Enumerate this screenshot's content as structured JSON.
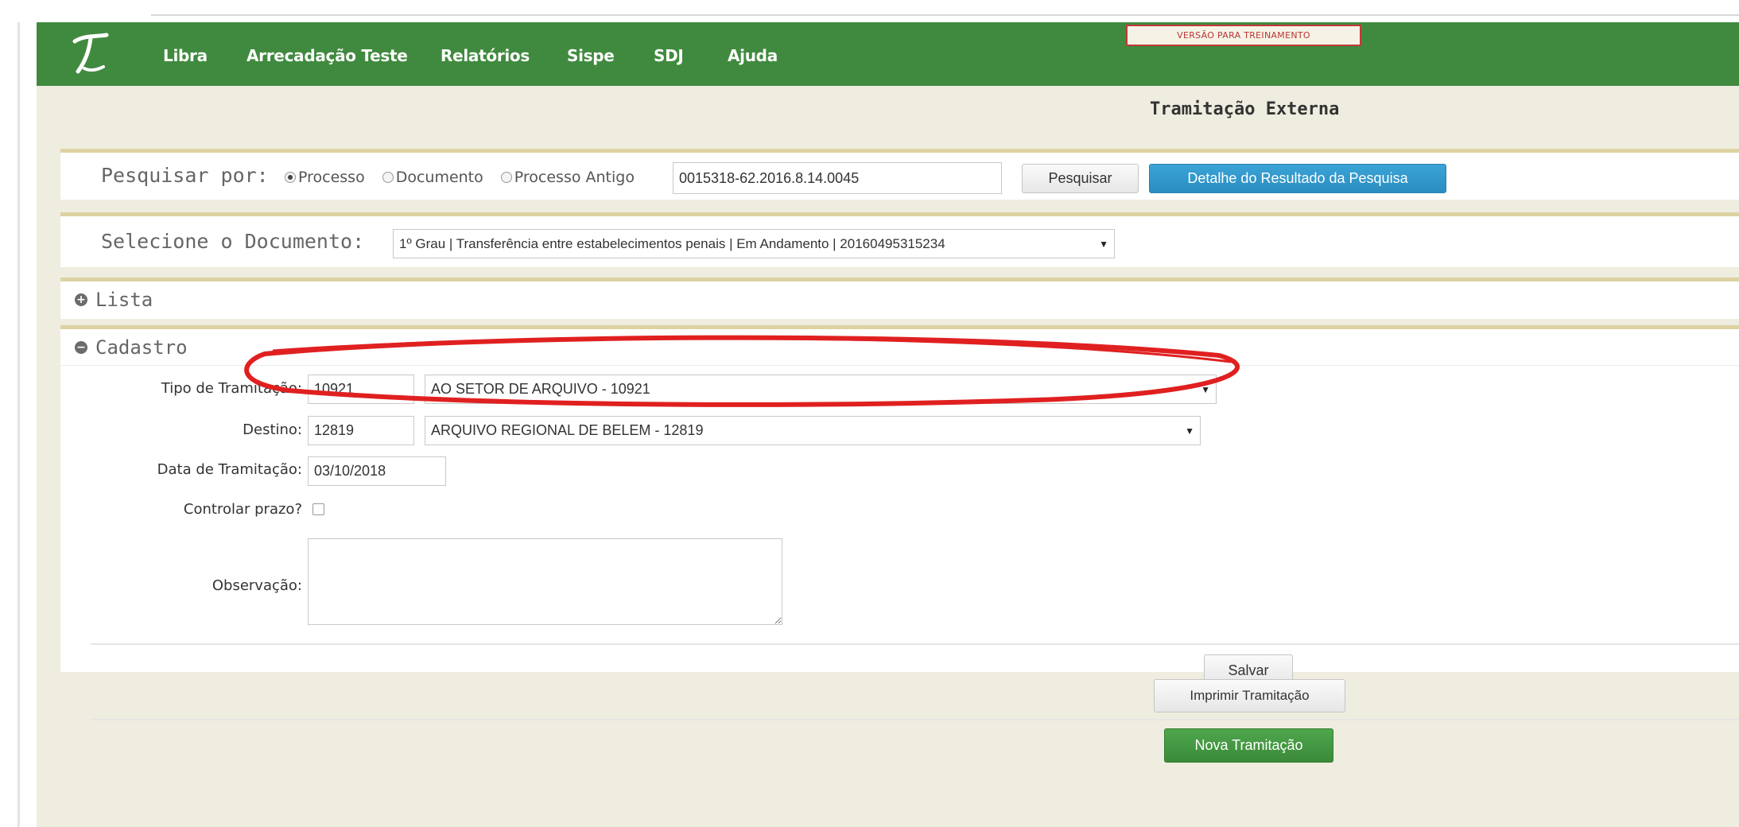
{
  "nav": {
    "items": [
      "Libra",
      "Arrecadação Teste",
      "Relatórios",
      "Sispe",
      "SDJ",
      "Ajuda"
    ],
    "training_badge": "VERSÃO PARA TREINAMENTO"
  },
  "page": {
    "title": "Tramitação Externa"
  },
  "search": {
    "label": "Pesquisar por:",
    "options": [
      "Processo",
      "Documento",
      "Processo Antigo"
    ],
    "selected": "Processo",
    "value": "0015318-62.2016.8.14.0045",
    "search_button": "Pesquisar",
    "details_button": "Detalhe do Resultado da Pesquisa"
  },
  "document": {
    "label": "Selecione o Documento:",
    "selected": "1º Grau | Transferência entre estabelecimentos penais | Em Andamento | 20160495315234"
  },
  "lista": {
    "title": "Lista"
  },
  "cadastro": {
    "title": "Cadastro",
    "tipo_label": "Tipo de Tramitação:",
    "tipo_code": "10921",
    "tipo_value": "AO SETOR DE ARQUIVO - 10921",
    "destino_label": "Destino:",
    "destino_code": "12819",
    "destino_value": "ARQUIVO REGIONAL DE BELEM - 12819",
    "data_label": "Data de Tramitação:",
    "data_value": "03/10/2018",
    "prazo_label": "Controlar prazo?",
    "obs_label": "Observação:",
    "save_button": "Salvar"
  },
  "actions": {
    "print_button": "Imprimir Tramitação",
    "new_button": "Nova Tramitação"
  },
  "colors": {
    "navbar": "#408a3f",
    "background": "#efeddf",
    "panel_border": "#ddd2a2",
    "highlight": "#e02020"
  }
}
